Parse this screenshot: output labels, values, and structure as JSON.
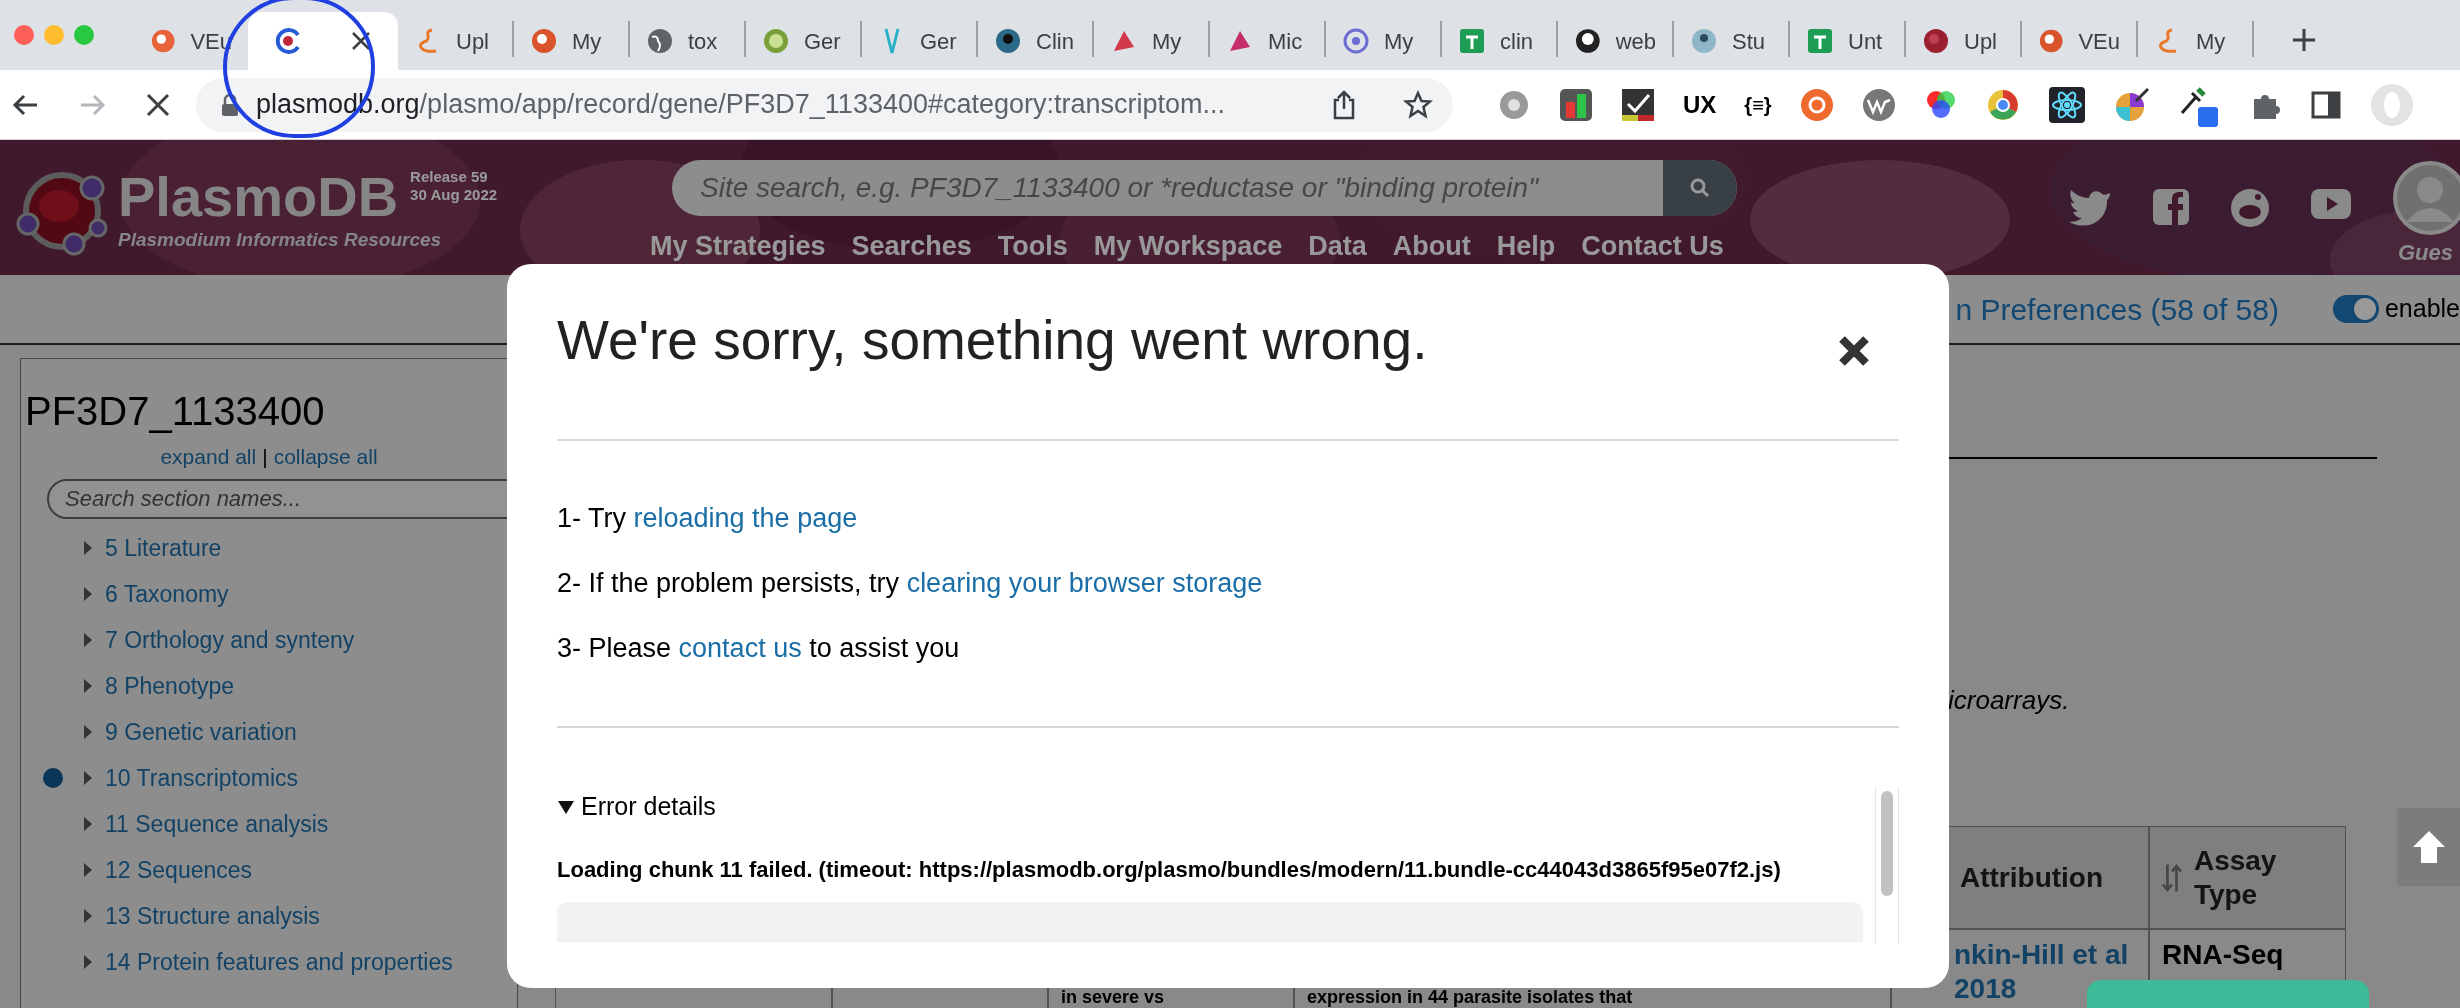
{
  "browser": {
    "tabs": [
      {
        "title": "VEu",
        "selected": false
      },
      {
        "selected": true
      },
      {
        "title": "Upl",
        "selected": false
      },
      {
        "title": "My",
        "selected": false
      },
      {
        "title": "tox",
        "selected": false
      },
      {
        "title": "Ger",
        "selected": false
      },
      {
        "title": "Ger",
        "selected": false
      },
      {
        "title": "Clin",
        "selected": false
      },
      {
        "title": "My",
        "selected": false
      },
      {
        "title": "Mic",
        "selected": false
      },
      {
        "title": "My",
        "selected": false
      },
      {
        "title": "clin",
        "selected": false
      },
      {
        "title": "web",
        "selected": false
      },
      {
        "title": "Stu",
        "selected": false
      },
      {
        "title": "Unt",
        "selected": false
      },
      {
        "title": "Upl",
        "selected": false
      },
      {
        "title": "VEu",
        "selected": false
      },
      {
        "title": "My",
        "selected": false
      }
    ],
    "address": {
      "domain": "plasmodb.org",
      "path": "/plasmo/app/record/gene/PF3D7_1133400#category:transcriptom..."
    },
    "extension_labels": [
      "UX",
      "{≡}"
    ]
  },
  "site_header": {
    "logo_name": "PlasmoDB",
    "tagline": "Plasmodium Informatics Resources",
    "release": "Release 59",
    "release_date": "30 Aug 2022",
    "search_placeholder": "Site search, e.g. PF3D7_1133400 or *reductase or \"binding protein\"",
    "nav": [
      "My Strategies",
      "Searches",
      "Tools",
      "My Workspace",
      "Data",
      "About",
      "Help",
      "Contact Us"
    ],
    "user_label": "Gues"
  },
  "preferences_bar": {
    "text": "n Preferences (58 of 58)",
    "toggle_on": true,
    "toggle_label": "enable"
  },
  "sidebar": {
    "title": "PF3D7_1133400",
    "expand_all": "expand all",
    "separator": "|",
    "collapse_all": "collapse all",
    "search_placeholder": "Search section names...",
    "sections": [
      {
        "label": "5 Literature",
        "selected": false
      },
      {
        "label": "6 Taxonomy",
        "selected": false
      },
      {
        "label": "7 Orthology and synteny",
        "selected": false
      },
      {
        "label": "8 Phenotype",
        "selected": false
      },
      {
        "label": "9 Genetic variation",
        "selected": false
      },
      {
        "label": "10 Transcriptomics",
        "selected": true
      },
      {
        "label": "11 Sequence analysis",
        "selected": false
      },
      {
        "label": "12 Sequences",
        "selected": false
      },
      {
        "label": "13 Structure analysis",
        "selected": false
      },
      {
        "label": "14 Protein features and properties",
        "selected": false
      }
    ]
  },
  "record": {
    "description_tail": "icroarrays.",
    "table": {
      "columns": [
        {
          "label": "Attribution"
        },
        {
          "label": "Assay Type",
          "sortable": true
        }
      ],
      "row": [
        {
          "text": "in severe vs",
          "kind": "text"
        },
        {
          "text": "expression in 44 parasite isolates that",
          "kind": "text"
        },
        {
          "text": "nkin-Hill et al 2018",
          "kind": "link"
        },
        {
          "text": "RNA-Seq",
          "kind": "text"
        }
      ]
    }
  },
  "error_dialog": {
    "title": "We're sorry, something went wrong.",
    "steps": [
      {
        "before": "1- Try",
        "link": "reloading the page"
      },
      {
        "before": "2- If the problem persists, try",
        "link": "clearing your browser storage"
      },
      {
        "before": "3- Please",
        "link": "contact us",
        "after": "to assist you"
      }
    ],
    "details": {
      "label": "Error details",
      "expanded": true,
      "message": "Loading chunk 11 failed. (timeout: https://plasmodb.org/plasmo/bundles/modern/11.bundle-cc44043d3865f95e07f2.js)"
    }
  }
}
